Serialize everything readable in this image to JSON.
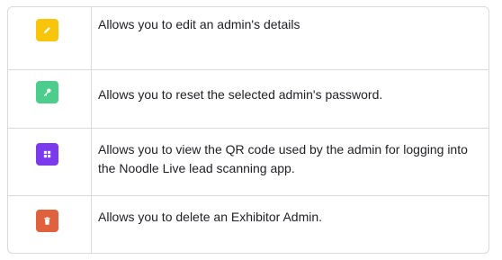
{
  "actions": [
    {
      "key": "edit",
      "icon": "pencil-icon",
      "color": "#f8c50b",
      "description": "Allows you to edit an admin's details"
    },
    {
      "key": "reset-password",
      "icon": "key-icon",
      "color": "#4ccd8b",
      "description": "Allows you to reset the selected admin's password."
    },
    {
      "key": "qr-code",
      "icon": "grid-icon",
      "color": "#7c3aed",
      "description": "Allows you to view the QR code used by the admin for logging into the Noodle Live lead scanning app."
    },
    {
      "key": "delete",
      "icon": "trash-icon",
      "color": "#e0613e",
      "description": "Allows you to delete an Exhibitor Admin."
    }
  ]
}
